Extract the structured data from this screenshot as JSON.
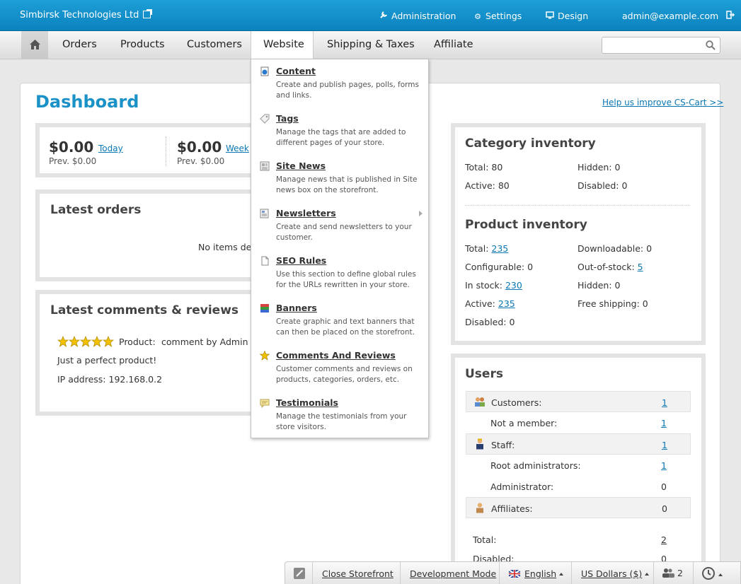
{
  "topbar": {
    "company": "Simbirsk Technologies Ltd",
    "links": {
      "administration": "Administration",
      "settings": "Settings",
      "design": "Design",
      "user": "admin@example.com"
    }
  },
  "nav": {
    "items": [
      "Orders",
      "Products",
      "Customers",
      "Website",
      "Shipping & Taxes",
      "Affiliate"
    ],
    "active": "Website",
    "search_value": ""
  },
  "page": {
    "title": "Dashboard",
    "help_link": "Help us improve CS-Cart >>"
  },
  "sales": [
    {
      "value": "$0.00",
      "period": "Today",
      "prev": "Prev. $0.00"
    },
    {
      "value": "$0.00",
      "period": "Week",
      "prev": "Prev. $0.00"
    }
  ],
  "latest_orders": {
    "title": "Latest orders",
    "empty": "No items def"
  },
  "comments": {
    "title": "Latest comments & reviews",
    "rating": 5,
    "product_label": "Product:",
    "comment_by": "comment by Admin Ad",
    "text": "Just a perfect product!",
    "ip": "IP address: 192.168.0.2"
  },
  "website_menu": [
    {
      "title": "Content",
      "desc": "Create and publish pages, polls, forms and links.",
      "icon": "content-icon"
    },
    {
      "title": "Tags",
      "desc": "Manage the tags that are added to different pages of your store.",
      "icon": "tag-icon"
    },
    {
      "title": "Site News",
      "desc": "Manage news that is published in Site news box on the storefront.",
      "icon": "news-icon"
    },
    {
      "title": "Newsletters",
      "desc": "Create and send newsletters to your customer.",
      "icon": "newsletter-icon",
      "submenu": true
    },
    {
      "title": "SEO Rules",
      "desc": "Use this section to define global rules for the URLs rewritten in your store.",
      "icon": "document-icon"
    },
    {
      "title": "Banners",
      "desc": "Create graphic and text banners that can then be placed on the storefront.",
      "icon": "banner-icon"
    },
    {
      "title": "Comments And Reviews",
      "desc": "Customer comments and reviews on products, categories, orders, etc.",
      "icon": "star-icon"
    },
    {
      "title": "Testimonials",
      "desc": "Manage the testimonials from your store visitors.",
      "icon": "testimonial-icon"
    }
  ],
  "category_inventory": {
    "title": "Category inventory",
    "total": "Total: 80",
    "hidden": "Hidden: 0",
    "active": "Active: 80",
    "disabled": "Disabled: 0"
  },
  "product_inventory": {
    "title": "Product inventory",
    "total_label": "Total:",
    "total": "235",
    "downloadable": "Downloadable: 0",
    "configurable": "Configurable: 0",
    "out_of_stock_label": "Out-of-stock:",
    "out_of_stock": "5",
    "in_stock_label": "In stock:",
    "in_stock": "230",
    "hidden": "Hidden: 0",
    "active_label": "Active:",
    "active": "235",
    "free_shipping": "Free shipping: 0",
    "disabled": "Disabled: 0"
  },
  "users": {
    "title": "Users",
    "rows": [
      {
        "label": "Customers:",
        "value": "1",
        "link": true
      },
      {
        "label": "Not a member:",
        "value": "1",
        "link": true
      },
      {
        "label": "Staff:",
        "value": "1",
        "link": true
      },
      {
        "label": "Root administrators:",
        "value": "1",
        "link": true
      },
      {
        "label": "Administrator:",
        "value": "0",
        "link": false
      },
      {
        "label": "Affiliates:",
        "value": "0",
        "link": false
      }
    ],
    "total_label": "Total:",
    "total": "2",
    "disabled_label": "Disabled:",
    "disabled": "0"
  },
  "bottombar": {
    "close_storefront": "Close Storefront",
    "dev_mode": "Development Mode",
    "language": "English",
    "currency": "US Dollars ($)",
    "users_online": "2"
  },
  "colors": {
    "brand": "#0b8ac9",
    "title": "#1a92c8",
    "link": "#0a77b4"
  }
}
